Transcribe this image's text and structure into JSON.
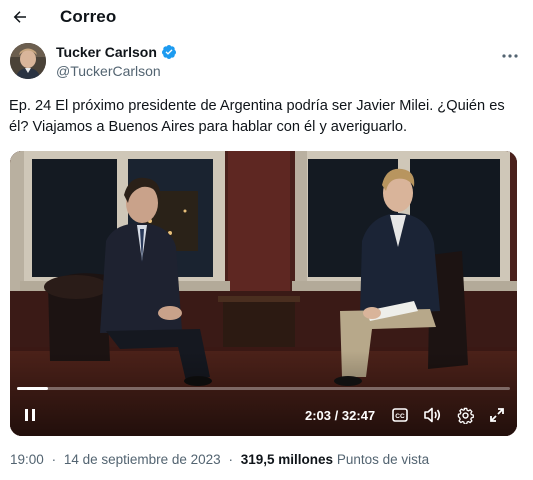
{
  "header": {
    "title": "Correo",
    "back_icon": "arrow-left-icon"
  },
  "author": {
    "display_name": "Tucker Carlson",
    "handle": "@TuckerCarlson",
    "verified_icon": "verified-badge-icon",
    "more_icon": "more-horizontal-icon",
    "verified_color": "#1d9bf0"
  },
  "tweet": {
    "text": "Ep. 24 El próximo presidente de Argentina podría ser Javier Milei. ¿Quién es él? Viajamos a Buenos Aires para hablar con él y averiguarlo."
  },
  "video": {
    "current_time": "2:03",
    "separator": "/",
    "duration": "32:47",
    "progress": 0.063,
    "controls": [
      "pause-icon",
      "closed-captions-icon",
      "volume-icon",
      "settings-gear-icon",
      "fullscreen-expand-icon"
    ]
  },
  "meta": {
    "time": "19:00",
    "dot": "·",
    "date": "14 de septiembre de 2023",
    "dot2": "·",
    "views": "319,5 millones",
    "views_label": "Puntos de vista"
  },
  "colors": {
    "text": "#0f1419",
    "secondary": "#536471",
    "accent": "#1d9bf0"
  }
}
